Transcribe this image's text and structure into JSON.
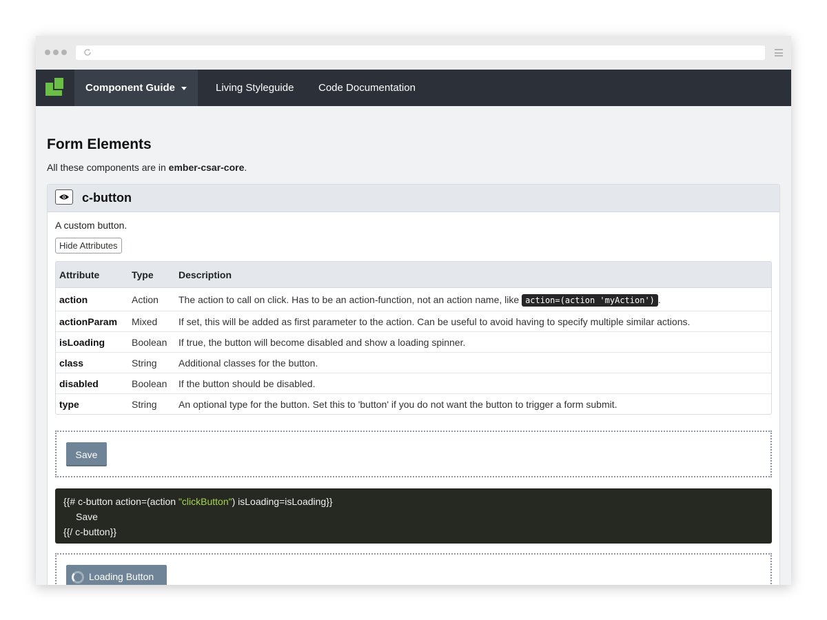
{
  "navbar": {
    "brand_color": "#6abf45",
    "items": [
      {
        "label": "Component Guide",
        "active": true,
        "has_dropdown": true
      },
      {
        "label": "Living Styleguide",
        "active": false
      },
      {
        "label": "Code Documentation",
        "active": false
      }
    ]
  },
  "page": {
    "title": "Form Elements",
    "intro_prefix": "All these components are in ",
    "intro_package": "ember-csar-core",
    "intro_suffix": "."
  },
  "component": {
    "name": "c-button",
    "description": "A custom button.",
    "toggle_label": "Hide Attributes",
    "table": {
      "headers": [
        "Attribute",
        "Type",
        "Description"
      ],
      "rows": [
        {
          "name": "action",
          "type": "Action",
          "description": "The action to call on click. Has to be an action-function, not an action name, like ",
          "code": "action=(action 'myAction')",
          "after": "."
        },
        {
          "name": "actionParam",
          "type": "Mixed",
          "description": "If set, this will be added as first parameter to the action. Can be useful to avoid having to specify multiple similar actions."
        },
        {
          "name": "isLoading",
          "type": "Boolean",
          "description": "If true, the button will become disabled and show a loading spinner."
        },
        {
          "name": "class",
          "type": "String",
          "description": "Additional classes for the button."
        },
        {
          "name": "disabled",
          "type": "Boolean",
          "description": "If the button should be disabled."
        },
        {
          "name": "type",
          "type": "String",
          "description": "An optional type for the button. Set this to 'button' if you do not want the button to trigger a form submit."
        }
      ]
    },
    "demo_save_label": "Save",
    "code": {
      "line1_prefix": "{{# c-button action=(action ",
      "line1_string": "\"clickButton\"",
      "line1_suffix": ") isLoading=isLoading}}",
      "line2": "Save",
      "line3": "{{/ c-button}}"
    },
    "demo_loading_label": "Loading Button"
  },
  "icons": {
    "eye": "eye-icon",
    "reload": "reload-icon",
    "menu": "hamburger-menu-icon",
    "spinner": "spinner-icon"
  }
}
